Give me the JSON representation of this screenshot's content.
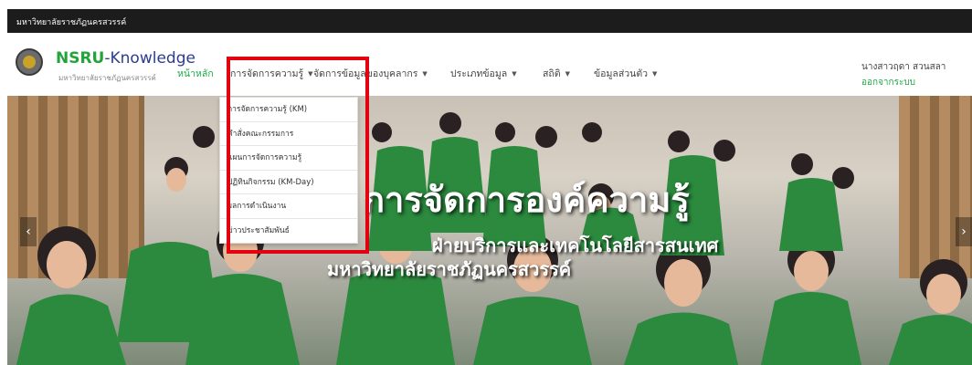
{
  "topbar": {
    "university": "มหาวิทยาลัยราชภัฏนครสวรรค์"
  },
  "navbar": {
    "logo_icon": "university-seal-icon",
    "brand_prefix": "NSRU",
    "brand_suffix": "-Knowledge",
    "brand_subtitle": "มหาวิทยาลัยราชภัฏนครสวรรค์",
    "menu": [
      {
        "label": "หน้าหลัก",
        "active": true
      },
      {
        "label": "การจัดการความรู้"
      },
      {
        "label": "จัดการข้อมูลของบุคลากร"
      },
      {
        "label": "ประเภทข้อมูล"
      },
      {
        "label": "สถิติ"
      },
      {
        "label": "ข้อมูลส่วนตัว"
      }
    ],
    "user_name": "นางสาวฤดา สวนสลา",
    "logout": "ออกจากระบบ"
  },
  "dropdown": {
    "items": [
      "การจัดการความรู้ (KM)",
      "คำสั่งคณะกรรมการ",
      "แผนการจัดการความรู้",
      "ปฏิทินกิจกรรม (KM-Day)",
      "ผลการดำเนินงาน",
      "ข่าวประชาสัมพันธ์"
    ]
  },
  "hero": {
    "title": "การจัดการองค์ความรู้",
    "subtitle_line1": "ฝ่ายบริการและเทคโนโลยีสารสนเทศ",
    "subtitle_line2": "มหาวิทยาลัยราชภัฏนครสวรรค์",
    "prev_label": "‹",
    "next_label": "›"
  },
  "colors": {
    "accent_green": "#1faa4a",
    "brand_blue": "#2b3d8f",
    "highlight_red": "#e3000f"
  }
}
